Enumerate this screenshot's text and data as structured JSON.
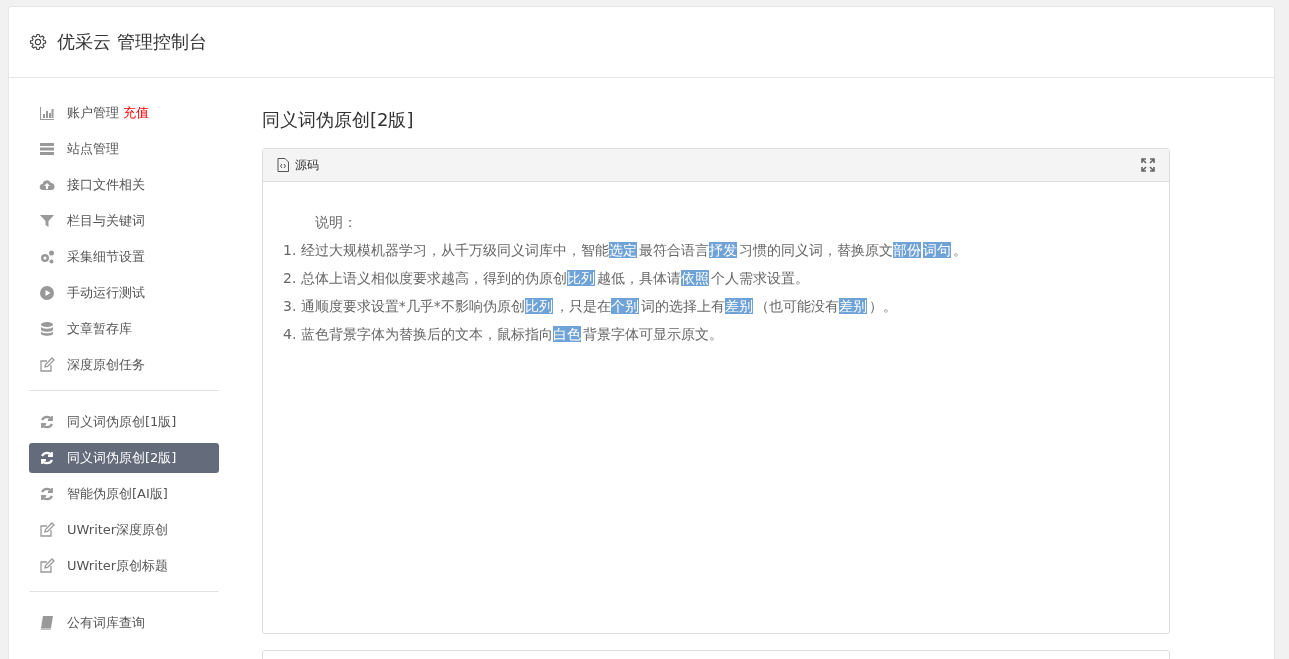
{
  "header": {
    "title": "优采云 管理控制台"
  },
  "sidebar": {
    "groups": [
      [
        {
          "label": "账户管理",
          "badge": "充值",
          "selected": false
        },
        {
          "label": "站点管理",
          "selected": false
        },
        {
          "label": "接口文件相关",
          "selected": false
        },
        {
          "label": "栏目与关键词",
          "selected": false
        },
        {
          "label": "采集细节设置",
          "selected": false
        },
        {
          "label": "手动运行测试",
          "selected": false
        },
        {
          "label": "文章暂存库",
          "selected": false
        },
        {
          "label": "深度原创任务",
          "selected": false
        }
      ],
      [
        {
          "label": "同义词伪原创[1版]",
          "selected": false
        },
        {
          "label": "同义词伪原创[2版]",
          "selected": true
        },
        {
          "label": "智能伪原创[AI版]",
          "selected": false
        },
        {
          "label": "UWriter深度原创",
          "selected": false
        },
        {
          "label": "UWriter原创标题",
          "selected": false
        }
      ],
      [
        {
          "label": "公有词库查询",
          "selected": false
        }
      ]
    ]
  },
  "content": {
    "title": "同义词伪原创[2版]",
    "editor": {
      "tab": "源码",
      "heading": "说明：",
      "lines": [
        [
          {
            "text": "1. 经过大规模机器学习，从千万级同义词库中，智能",
            "replaced": false
          },
          {
            "text": "选定",
            "replaced": true
          },
          {
            "text": "最符合语言",
            "replaced": false
          },
          {
            "text": "抒发",
            "replaced": true
          },
          {
            "text": "习惯的同义词，替换原文",
            "replaced": false
          },
          {
            "text": "部份",
            "replaced": true
          },
          {
            "text": "词句",
            "replaced": true
          },
          {
            "text": "。",
            "replaced": false
          }
        ],
        [
          {
            "text": "2. 总体上语义相似度要求越高，得到的伪原创",
            "replaced": false
          },
          {
            "text": "比列",
            "replaced": true
          },
          {
            "text": "越低，具体请",
            "replaced": false
          },
          {
            "text": "依照",
            "replaced": true
          },
          {
            "text": "个人需求设置。",
            "replaced": false
          }
        ],
        [
          {
            "text": "3. 通顺度要求设置*几乎*不影响伪原创",
            "replaced": false
          },
          {
            "text": "比列",
            "replaced": true
          },
          {
            "text": "，只是在",
            "replaced": false
          },
          {
            "text": "个别",
            "replaced": true
          },
          {
            "text": "词的选择上有",
            "replaced": false
          },
          {
            "text": "差别",
            "replaced": true
          },
          {
            "text": "（也可能没有",
            "replaced": false
          },
          {
            "text": "差别",
            "replaced": true
          },
          {
            "text": "）。",
            "replaced": false
          }
        ],
        [
          {
            "text": "4. 蓝色背景字体为替换后的文本，鼠标指向",
            "replaced": false
          },
          {
            "text": "白色",
            "replaced": true
          },
          {
            "text": "背景字体可显示原文。",
            "replaced": false
          }
        ]
      ]
    }
  }
}
